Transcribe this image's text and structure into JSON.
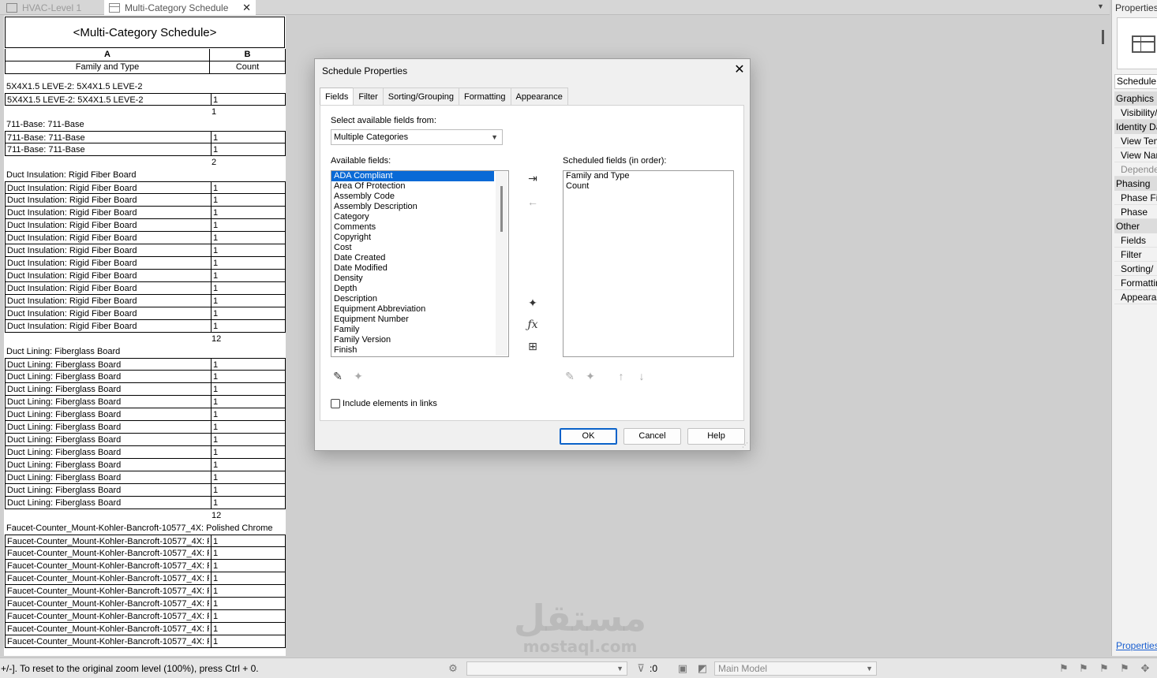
{
  "tabs": [
    {
      "label": "HVAC-Level 1",
      "active": false
    },
    {
      "label": "Multi-Category Schedule",
      "active": true,
      "close": "✕"
    }
  ],
  "schedule": {
    "title": "<Multi-Category Schedule>",
    "col_letters": [
      "A",
      "B"
    ],
    "fields": [
      "Family and Type",
      "Count"
    ],
    "groups": [
      {
        "header": "5X4X1.5 LEVE-2: 5X4X1.5 LEVE-2",
        "rows": [
          [
            "5X4X1.5 LEVE-2: 5X4X1.5 LEVE-2",
            "1"
          ]
        ],
        "total": "1"
      },
      {
        "header": "711-Base: 711-Base",
        "rows": [
          [
            "711-Base: 711-Base",
            "1"
          ],
          [
            "711-Base: 711-Base",
            "1"
          ]
        ],
        "total": "2"
      },
      {
        "header": "Duct Insulation: Rigid Fiber Board",
        "rows": [
          [
            "Duct Insulation: Rigid Fiber Board",
            "1"
          ],
          [
            "Duct Insulation: Rigid Fiber Board",
            "1"
          ],
          [
            "Duct Insulation: Rigid Fiber Board",
            "1"
          ],
          [
            "Duct Insulation: Rigid Fiber Board",
            "1"
          ],
          [
            "Duct Insulation: Rigid Fiber Board",
            "1"
          ],
          [
            "Duct Insulation: Rigid Fiber Board",
            "1"
          ],
          [
            "Duct Insulation: Rigid Fiber Board",
            "1"
          ],
          [
            "Duct Insulation: Rigid Fiber Board",
            "1"
          ],
          [
            "Duct Insulation: Rigid Fiber Board",
            "1"
          ],
          [
            "Duct Insulation: Rigid Fiber Board",
            "1"
          ],
          [
            "Duct Insulation: Rigid Fiber Board",
            "1"
          ],
          [
            "Duct Insulation: Rigid Fiber Board",
            "1"
          ]
        ],
        "total": "12"
      },
      {
        "header": "Duct Lining: Fiberglass Board",
        "rows": [
          [
            "Duct Lining: Fiberglass Board",
            "1"
          ],
          [
            "Duct Lining: Fiberglass Board",
            "1"
          ],
          [
            "Duct Lining: Fiberglass Board",
            "1"
          ],
          [
            "Duct Lining: Fiberglass Board",
            "1"
          ],
          [
            "Duct Lining: Fiberglass Board",
            "1"
          ],
          [
            "Duct Lining: Fiberglass Board",
            "1"
          ],
          [
            "Duct Lining: Fiberglass Board",
            "1"
          ],
          [
            "Duct Lining: Fiberglass Board",
            "1"
          ],
          [
            "Duct Lining: Fiberglass Board",
            "1"
          ],
          [
            "Duct Lining: Fiberglass Board",
            "1"
          ],
          [
            "Duct Lining: Fiberglass Board",
            "1"
          ],
          [
            "Duct Lining: Fiberglass Board",
            "1"
          ]
        ],
        "total": "12"
      },
      {
        "header": "Faucet-Counter_Mount-Kohler-Bancroft-10577_4X: Polished Chrome",
        "rows": [
          [
            "Faucet-Counter_Mount-Kohler-Bancroft-10577_4X: P",
            "1"
          ],
          [
            "Faucet-Counter_Mount-Kohler-Bancroft-10577_4X: P",
            "1"
          ],
          [
            "Faucet-Counter_Mount-Kohler-Bancroft-10577_4X: P",
            "1"
          ],
          [
            "Faucet-Counter_Mount-Kohler-Bancroft-10577_4X: P",
            "1"
          ],
          [
            "Faucet-Counter_Mount-Kohler-Bancroft-10577_4X: P",
            "1"
          ],
          [
            "Faucet-Counter_Mount-Kohler-Bancroft-10577_4X: P",
            "1"
          ],
          [
            "Faucet-Counter_Mount-Kohler-Bancroft-10577_4X: P",
            "1"
          ],
          [
            "Faucet-Counter_Mount-Kohler-Bancroft-10577_4X: P",
            "1"
          ],
          [
            "Faucet-Counter_Mount-Kohler-Bancroft-10577_4X: P",
            "1"
          ]
        ],
        "total": ""
      }
    ]
  },
  "dialog": {
    "title": "Schedule Properties",
    "close": "✕",
    "tabs": [
      "Fields",
      "Filter",
      "Sorting/Grouping",
      "Formatting",
      "Appearance"
    ],
    "select_label": "Select available fields from:",
    "select_value": "Multiple Categories",
    "available_label": "Available fields:",
    "available_fields": [
      "ADA Compliant",
      "Area Of Protection",
      "Assembly Code",
      "Assembly Description",
      "Category",
      "Comments",
      "Copyright",
      "Cost",
      "Date Created",
      "Date Modified",
      "Density",
      "Depth",
      "Description",
      "Equipment Abbreviation",
      "Equipment Number",
      "Family",
      "Family Version",
      "Finish"
    ],
    "selected_available": "ADA Compliant",
    "scheduled_label": "Scheduled fields (in order):",
    "scheduled_fields": [
      "Family and Type",
      "Count"
    ],
    "include_links_label": "Include elements in links",
    "include_links_checked": false,
    "ok": "OK",
    "cancel": "Cancel",
    "help": "Help"
  },
  "properties": {
    "title": "Properties",
    "type_selector": "Schedule:",
    "items": [
      {
        "label": "Graphics",
        "kind": "category"
      },
      {
        "label": "Visibility/",
        "kind": "item"
      },
      {
        "label": "Identity Da",
        "kind": "category"
      },
      {
        "label": "View Tem",
        "kind": "item"
      },
      {
        "label": "View Nar",
        "kind": "item"
      },
      {
        "label": "Depende",
        "kind": "item-dim"
      },
      {
        "label": "Phasing",
        "kind": "category"
      },
      {
        "label": "Phase Fil",
        "kind": "item"
      },
      {
        "label": "Phase",
        "kind": "item"
      },
      {
        "label": "Other",
        "kind": "category"
      },
      {
        "label": "Fields",
        "kind": "item"
      },
      {
        "label": "Filter",
        "kind": "item"
      },
      {
        "label": "Sorting/",
        "kind": "item"
      },
      {
        "label": "Formattin",
        "kind": "item"
      },
      {
        "label": "Appearar",
        "kind": "item"
      }
    ],
    "link": "Properties"
  },
  "statusbar": {
    "hint": "+/-]. To reset to the original zoom level (100%), press Ctrl + 0.",
    "selection_count": ":0",
    "model": "Main Model"
  },
  "watermark": {
    "arabic": "مستقل",
    "latin": "mostaql.com"
  },
  "colors": {
    "selection": "#0a6ad6",
    "ok_border": "#0a62c9",
    "link": "#1a5fd0"
  }
}
